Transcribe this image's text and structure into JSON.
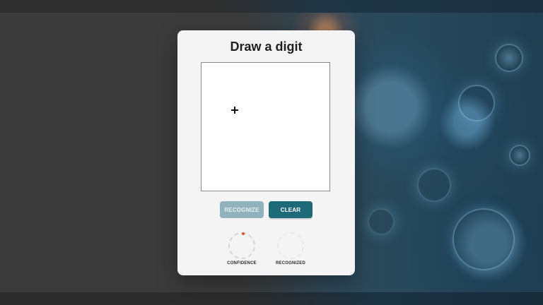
{
  "card": {
    "title": "Draw a digit"
  },
  "buttons": {
    "recognize_label": "RECOGNIZE",
    "clear_label": "CLEAR"
  },
  "metrics": {
    "confidence_label": "CONFIDENCE",
    "recognized_label": "RECOGNIZED"
  },
  "icons": {
    "crosshair": "crosshair-icon",
    "confidence_indicator": "confidence-indicator-dot"
  },
  "colors": {
    "clear_button": "#1f6a78",
    "recognize_button_disabled": "#8fb2bc",
    "indicator_dot": "#e0562a"
  }
}
